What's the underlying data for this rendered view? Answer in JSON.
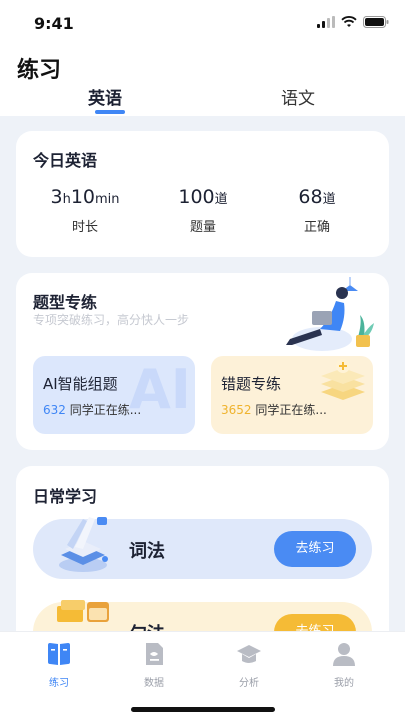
{
  "status": {
    "time": "9:41"
  },
  "header": {
    "title": "练习",
    "tabs": [
      "英语",
      "语文"
    ]
  },
  "today": {
    "title": "今日英语",
    "stats": [
      {
        "num1": "3",
        "unit1": "h",
        "num2": "10",
        "unit2": "min",
        "label": "时长"
      },
      {
        "num1": "100",
        "unit1": "道",
        "label": "题量"
      },
      {
        "num1": "68",
        "unit1": "道",
        "label": "正确"
      }
    ]
  },
  "practice": {
    "title": "题型专练",
    "subtitle": "专项突破练习，高分快人一步",
    "tiles": [
      {
        "title": "AI智能组题",
        "count": "632",
        "suffix": "同学正在练..."
      },
      {
        "title": "错题专练",
        "count": "3652",
        "suffix": "同学正在练..."
      }
    ]
  },
  "daily": {
    "title": "日常学习",
    "items": [
      {
        "label": "词法",
        "button": "去练习"
      },
      {
        "label": "句法",
        "button": "去练习"
      }
    ]
  },
  "tabbar": {
    "items": [
      {
        "label": "练习",
        "icon": "book-icon",
        "active": true
      },
      {
        "label": "数据",
        "icon": "document-icon",
        "active": false
      },
      {
        "label": "分析",
        "icon": "graduation-cap-icon",
        "active": false
      },
      {
        "label": "我的",
        "icon": "person-icon",
        "active": false
      }
    ]
  },
  "colors": {
    "accent": "#3f86f5",
    "orange": "#f5bb36",
    "background": "#eef2f8"
  }
}
